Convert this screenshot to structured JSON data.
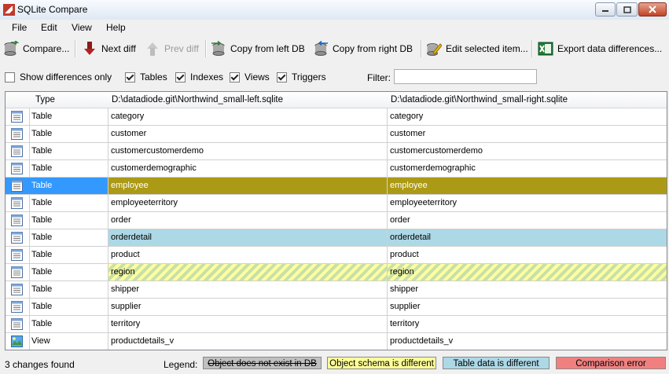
{
  "window": {
    "title": "SQLite Compare"
  },
  "menu": [
    "File",
    "Edit",
    "View",
    "Help"
  ],
  "toolbar": {
    "compare": "Compare...",
    "next_diff": "Next diff",
    "prev_diff": "Prev diff",
    "copy_left": "Copy from left DB",
    "copy_right": "Copy from right DB",
    "edit_selected": "Edit selected item...",
    "export": "Export data differences..."
  },
  "filters": {
    "show_differences_only": {
      "label": "Show differences only",
      "checked": false
    },
    "tables": {
      "label": "Tables",
      "checked": true
    },
    "indexes": {
      "label": "Indexes",
      "checked": true
    },
    "views": {
      "label": "Views",
      "checked": true
    },
    "triggers": {
      "label": "Triggers",
      "checked": true
    },
    "filter_label": "Filter:",
    "filter_value": ""
  },
  "grid": {
    "headers": {
      "type": "Type",
      "left": "D:\\datadiode.git\\Northwind_small-left.sqlite",
      "right": "D:\\datadiode.git\\Northwind_small-right.sqlite"
    },
    "rows": [
      {
        "type": "Table",
        "left": "category",
        "right": "category",
        "status": "same",
        "icon": "table-icon"
      },
      {
        "type": "Table",
        "left": "customer",
        "right": "customer",
        "status": "same",
        "icon": "table-icon"
      },
      {
        "type": "Table",
        "left": "customercustomerdemo",
        "right": "customercustomerdemo",
        "status": "same",
        "icon": "table-icon"
      },
      {
        "type": "Table",
        "left": "customerdemographic",
        "right": "customerdemographic",
        "status": "same",
        "icon": "table-icon"
      },
      {
        "type": "Table",
        "left": "employee",
        "right": "employee",
        "status": "selected",
        "icon": "table-icon"
      },
      {
        "type": "Table",
        "left": "employeeterritory",
        "right": "employeeterritory",
        "status": "same",
        "icon": "table-icon"
      },
      {
        "type": "Table",
        "left": "order",
        "right": "order",
        "status": "same",
        "icon": "table-icon"
      },
      {
        "type": "Table",
        "left": "orderdetail",
        "right": "orderdetail",
        "status": "data-diff",
        "icon": "table-icon"
      },
      {
        "type": "Table",
        "left": "product",
        "right": "product",
        "status": "same",
        "icon": "table-icon"
      },
      {
        "type": "Table",
        "left": "region",
        "right": "region",
        "status": "schema-diff",
        "icon": "table-icon"
      },
      {
        "type": "Table",
        "left": "shipper",
        "right": "shipper",
        "status": "same",
        "icon": "table-icon"
      },
      {
        "type": "Table",
        "left": "supplier",
        "right": "supplier",
        "status": "same",
        "icon": "table-icon"
      },
      {
        "type": "Table",
        "left": "territory",
        "right": "territory",
        "status": "same",
        "icon": "table-icon"
      },
      {
        "type": "View",
        "left": "productdetails_v",
        "right": "productdetails_v",
        "status": "same",
        "icon": "view-icon"
      }
    ]
  },
  "status": {
    "text": "3 changes found",
    "legend_label": "Legend:",
    "legend": [
      {
        "label": "Object does not exist in DB",
        "color": "#c0c0c0"
      },
      {
        "label": "Object schema is different",
        "color": "#ffff99"
      },
      {
        "label": "Table data is different",
        "color": "#add8e6"
      },
      {
        "label": "Comparison error",
        "color": "#f08080"
      }
    ]
  }
}
